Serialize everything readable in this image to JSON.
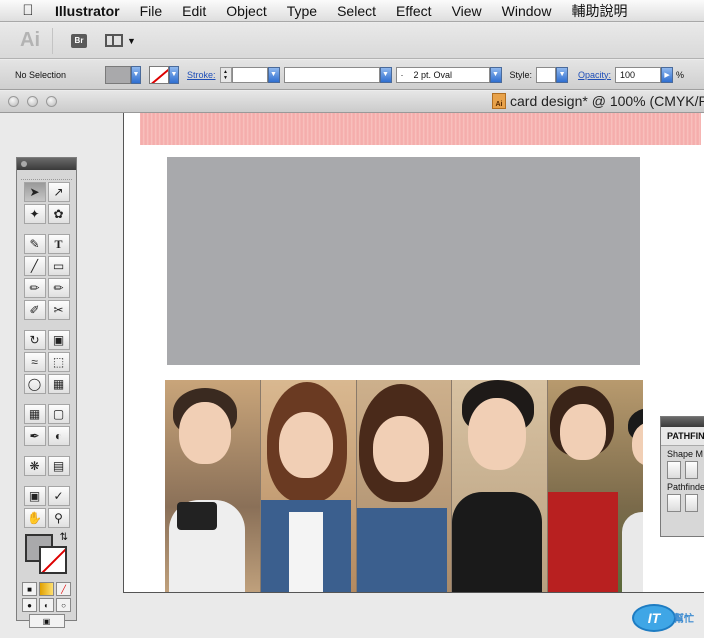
{
  "menubar": {
    "app": "Illustrator",
    "items": [
      "File",
      "Edit",
      "Object",
      "Type",
      "Select",
      "Effect",
      "View",
      "Window",
      "輔助說明"
    ]
  },
  "appbar": {
    "logo": "Ai",
    "bridge_label": "Br"
  },
  "control": {
    "selection_label": "No Selection",
    "stroke_label": "Stroke:",
    "brush_value": "2 pt. Oval",
    "brush_dot": "·",
    "style_label": "Style:",
    "opacity_label": "Opacity:",
    "opacity_value": "100",
    "percent": "%"
  },
  "document": {
    "title": "card design* @ 100% (CMYK/P"
  },
  "pathfinder": {
    "tab": "PATHFIN",
    "shape_modes_label": "Shape M",
    "pathfinders_label": "Pathfinde"
  },
  "watermark": {
    "logo": "IT",
    "text": "幫忙"
  },
  "colors": {
    "fill": "#a9a9ab",
    "pink_strip": "#f7b9b7",
    "accent": "#2f6fd1"
  }
}
